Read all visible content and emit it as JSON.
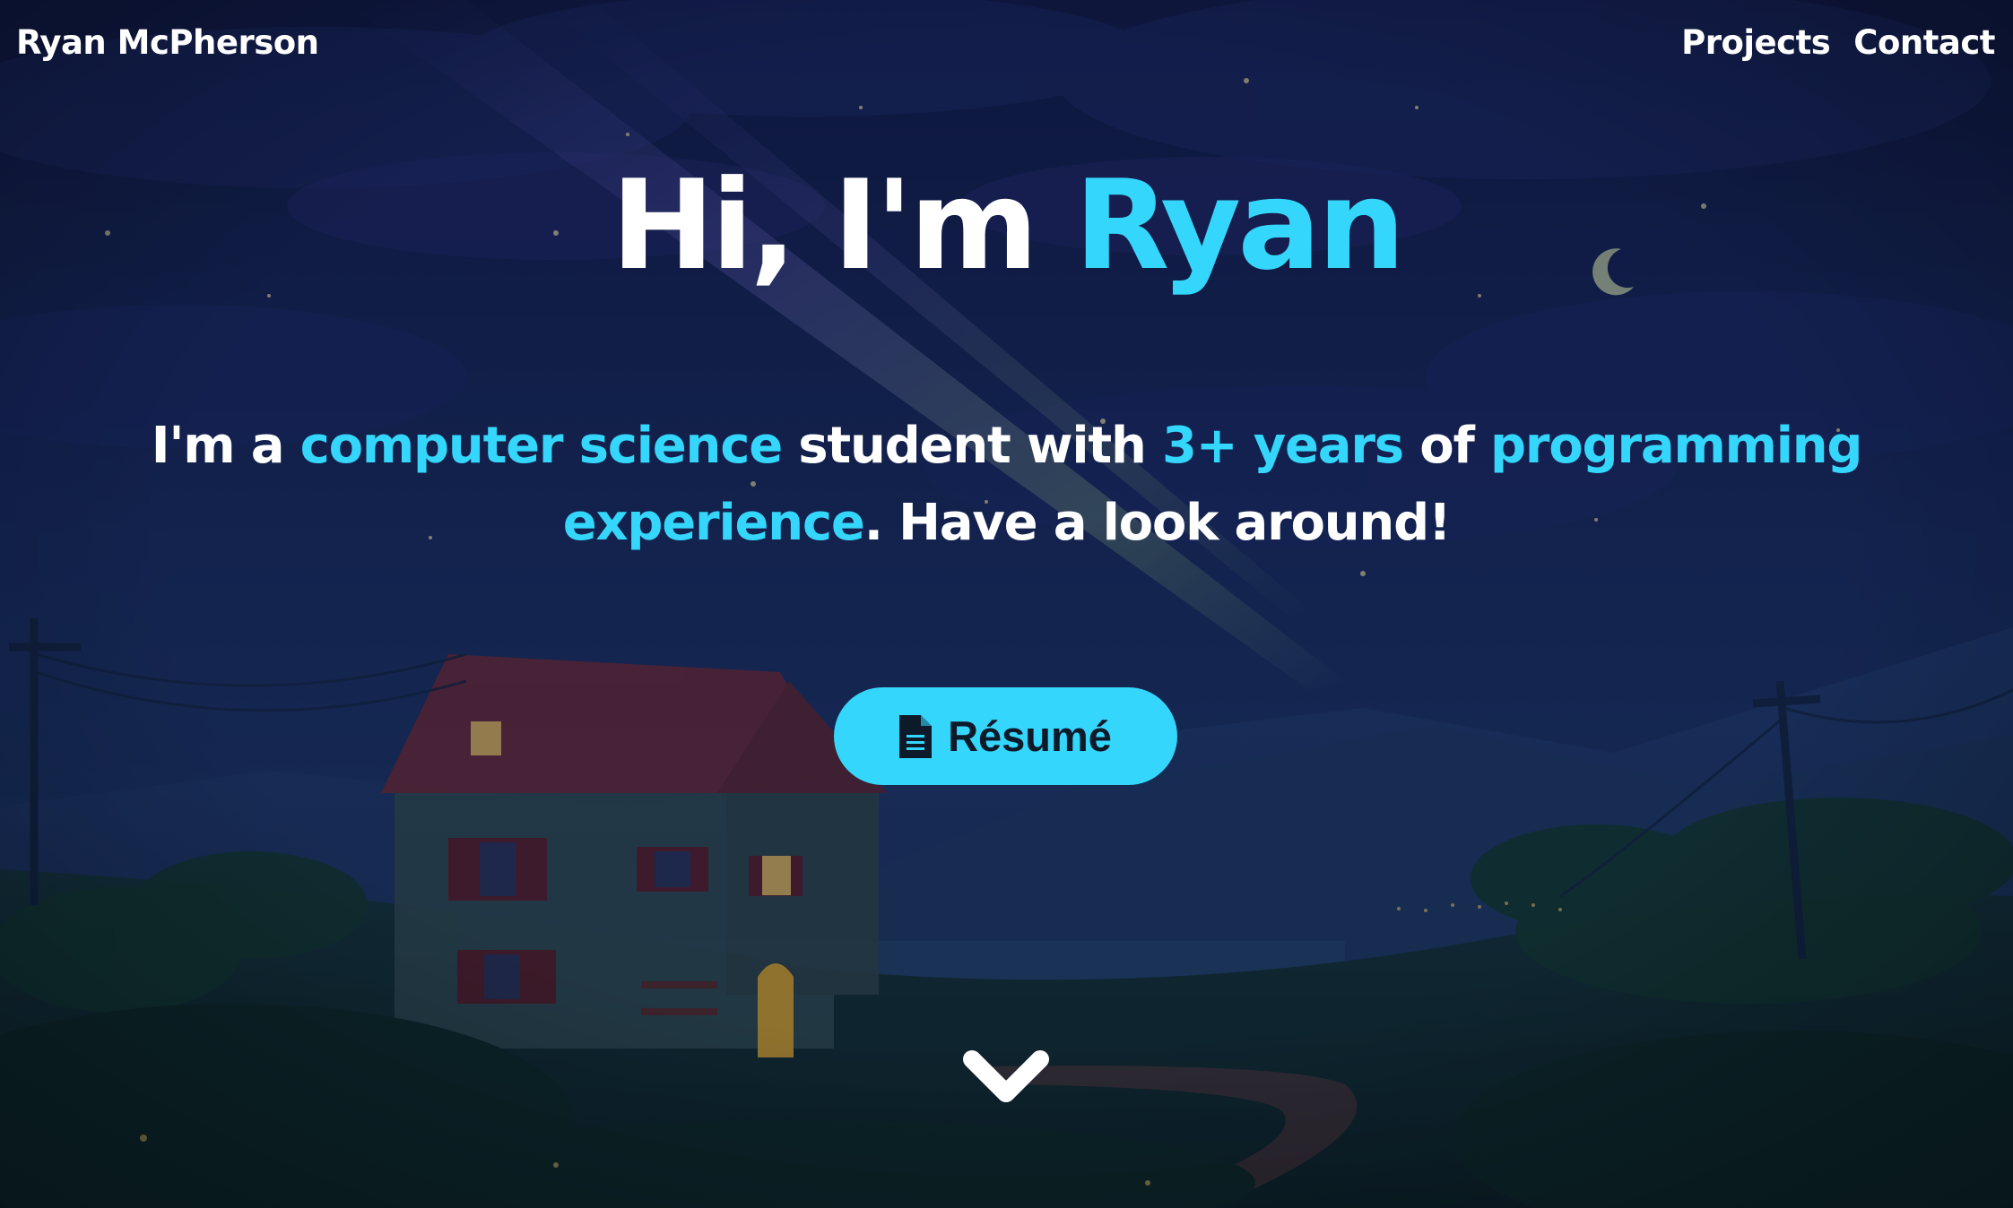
{
  "nav": {
    "brand": "Ryan McPherson",
    "links": [
      {
        "label": "Projects"
      },
      {
        "label": "Contact"
      }
    ]
  },
  "hero": {
    "greeting": "Hi, I'm ",
    "name": "Ryan",
    "tagline": [
      {
        "text": "I'm a ",
        "accent": false
      },
      {
        "text": "computer science",
        "accent": true
      },
      {
        "text": " student with ",
        "accent": false
      },
      {
        "text": "3+ years",
        "accent": true
      },
      {
        "text": " of ",
        "accent": false
      },
      {
        "text": "programming experience",
        "accent": true
      },
      {
        "text": ". Have a look around!",
        "accent": false
      }
    ],
    "resume_button": {
      "label": "Résumé",
      "icon": "document-icon"
    },
    "scroll_icon": "chevron-down-icon"
  },
  "theme": {
    "accent": "#35d6fb",
    "text": "#ffffff",
    "button_text": "#0d1a2a"
  }
}
